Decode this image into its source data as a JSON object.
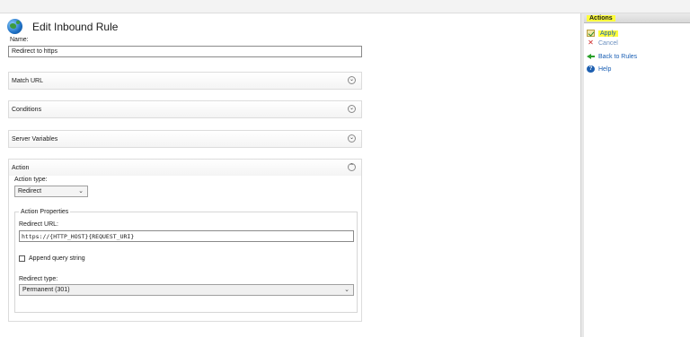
{
  "header": {
    "title": "Edit Inbound Rule",
    "icon": "globe-icon"
  },
  "name": {
    "label": "Name:",
    "value": "Redirect to https"
  },
  "sections": {
    "match_url": "Match URL",
    "conditions": "Conditions",
    "server_variables": "Server Variables",
    "action": "Action"
  },
  "action": {
    "action_type_label": "Action type:",
    "action_type_value": "Redirect",
    "properties_legend": "Action Properties",
    "redirect_url_label": "Redirect URL:",
    "redirect_url_value": "https://{HTTP_HOST}{REQUEST_URI}",
    "append_query_label": "Append query string",
    "append_query_checked": false,
    "redirect_type_label": "Redirect type:",
    "redirect_type_value": "Permanent (301)"
  },
  "actions_pane": {
    "title": "Actions",
    "items": [
      {
        "label": "Apply",
        "icon": "apply-icon",
        "highlight": "#fdfd3a"
      },
      {
        "label": "Cancel",
        "icon": "cancel-icon"
      },
      {
        "label": "Back to Rules",
        "icon": "back-arrow-icon"
      },
      {
        "label": "Help",
        "icon": "help-icon"
      }
    ]
  },
  "colors": {
    "link": "#1a5fb4",
    "highlight": "#fdfd3a"
  }
}
